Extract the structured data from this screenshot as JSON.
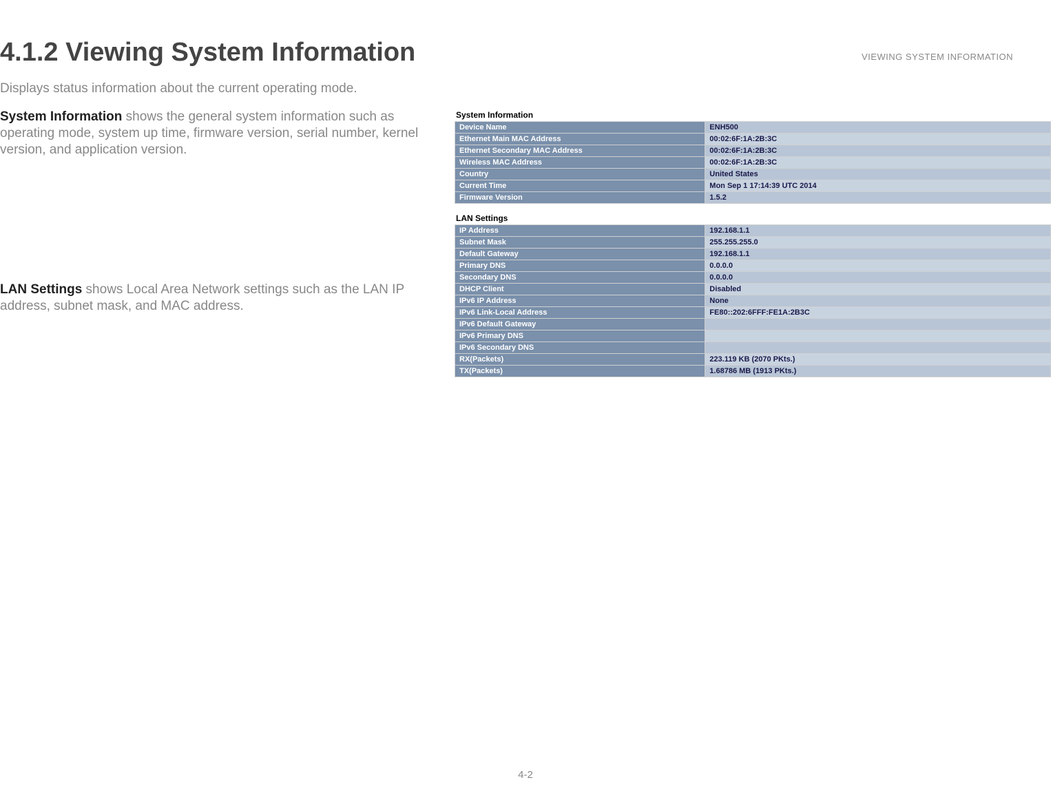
{
  "header_small": "VIEWING SYSTEM INFORMATION",
  "heading": "4.1.2 Viewing System Information",
  "intro": "Displays status information about the current operating mode.",
  "sysinfo_label": "System Information",
  "sysinfo_text": "  shows the general system information such as operating mode, system up time, firmware version, serial number, kernel version, and application version.",
  "lan_label": "LAN Settings",
  "lan_text": "  shows Local Area Network settings such as the LAN IP address, subnet mask, and MAC address.",
  "page_number": "4-2",
  "panel1_title": "System Information",
  "panel1_rows": [
    {
      "label": "Device Name",
      "value": "ENH500"
    },
    {
      "label": "Ethernet Main MAC Address",
      "value": "00:02:6F:1A:2B:3C"
    },
    {
      "label": "Ethernet Secondary MAC Address",
      "value": "00:02:6F:1A:2B:3C"
    },
    {
      "label": "Wireless MAC Address",
      "value": "00:02:6F:1A:2B:3C"
    },
    {
      "label": "Country",
      "value": "United States"
    },
    {
      "label": "Current Time",
      "value": "Mon Sep 1 17:14:39 UTC 2014"
    },
    {
      "label": "Firmware Version",
      "value": "1.5.2"
    }
  ],
  "panel2_title": "LAN Settings",
  "panel2_rows": [
    {
      "label": "IP Address",
      "value": "192.168.1.1"
    },
    {
      "label": "Subnet Mask",
      "value": "255.255.255.0"
    },
    {
      "label": "Default Gateway",
      "value": "192.168.1.1"
    },
    {
      "label": "Primary DNS",
      "value": "0.0.0.0"
    },
    {
      "label": "Secondary DNS",
      "value": "0.0.0.0"
    },
    {
      "label": "DHCP Client",
      "value": "Disabled"
    },
    {
      "label": "IPv6 IP Address",
      "value": "None"
    },
    {
      "label": "IPv6 Link-Local Address",
      "value": "FE80::202:6FFF:FE1A:2B3C"
    },
    {
      "label": "IPv6 Default Gateway",
      "value": ""
    },
    {
      "label": "IPv6 Primary DNS",
      "value": ""
    },
    {
      "label": "IPv6 Secondary DNS",
      "value": ""
    },
    {
      "label": "RX(Packets)",
      "value": "223.119 KB (2070 PKts.)"
    },
    {
      "label": "TX(Packets)",
      "value": "1.68786 MB (1913 PKts.)"
    }
  ]
}
